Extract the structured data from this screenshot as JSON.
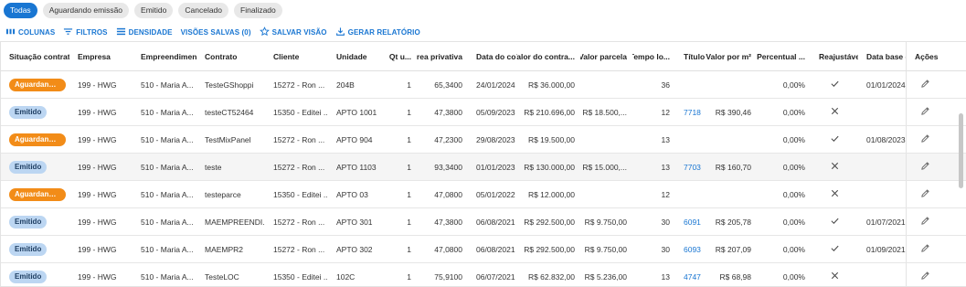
{
  "tabs": [
    {
      "label": "Todas",
      "active": true
    },
    {
      "label": "Aguardando emissão",
      "active": false
    },
    {
      "label": "Emitido",
      "active": false
    },
    {
      "label": "Cancelado",
      "active": false
    },
    {
      "label": "Finalizado",
      "active": false
    }
  ],
  "toolbar": {
    "columns": "COLUNAS",
    "filters": "FILTROS",
    "density": "DENSIDADE",
    "saved_views": "VISÕES SALVAS (0)",
    "save_view": "SALVAR VISÃO",
    "report": "GERAR RELATÓRIO"
  },
  "columns": {
    "situacao": "Situação contrato",
    "empresa": "Empresa",
    "empreendimento": "Empreendimento",
    "contrato": "Contrato",
    "cliente": "Cliente",
    "unidade": "Unidade",
    "qt": "Qt u...",
    "area": "Área privativa",
    "data": "Data do con...",
    "valor": "Valor do contra...",
    "parcela": "Valor parcela",
    "tempo": "Tempo lo...",
    "titulo": "Título",
    "valor_m2": "Valor por m²",
    "percentual": "Percentual ...",
    "reajustavel": "Reajustável",
    "data_base": "Data base d...",
    "acoes": "Ações"
  },
  "colors": {
    "primary": "#1976d2",
    "orange": "#f28c18",
    "blue_badge": "#bcd6f2"
  },
  "rows": [
    {
      "status": "Aguardando ...",
      "status_type": "orange",
      "empresa": "199 - HWG",
      "empreendimento": "510 - Maria A...",
      "contrato": "TesteGShoppi",
      "cliente": "15272 - Ron ...",
      "unidade": "204B",
      "qt": "1",
      "area": "65,3400",
      "data": "24/01/2024",
      "valor": "R$ 36.000,00",
      "parcela": "",
      "tempo": "36",
      "titulo": "",
      "valor_m2": "",
      "percentual": "0,00%",
      "reajustavel": "check",
      "data_base": "01/01/2024",
      "highlight": false
    },
    {
      "status": "Emitido",
      "status_type": "blue",
      "empresa": "199 - HWG",
      "empreendimento": "510 - Maria A...",
      "contrato": "testeCT52464",
      "cliente": "15350 - Editei ...",
      "unidade": "APTO 1001",
      "qt": "1",
      "area": "47,3800",
      "data": "05/09/2023",
      "valor": "R$ 210.696,00",
      "parcela": "R$ 18.500,...",
      "tempo": "12",
      "titulo": "7718",
      "valor_m2": "R$ 390,46",
      "percentual": "0,00%",
      "reajustavel": "close",
      "data_base": "",
      "highlight": false
    },
    {
      "status": "Aguardando ...",
      "status_type": "orange",
      "empresa": "199 - HWG",
      "empreendimento": "510 - Maria A...",
      "contrato": "TestMixPanel",
      "cliente": "15272 - Ron ...",
      "unidade": "APTO 904",
      "qt": "1",
      "area": "47,2300",
      "data": "29/08/2023",
      "valor": "R$ 19.500,00",
      "parcela": "",
      "tempo": "13",
      "titulo": "",
      "valor_m2": "",
      "percentual": "0,00%",
      "reajustavel": "check",
      "data_base": "01/08/2023",
      "highlight": false
    },
    {
      "status": "Emitido",
      "status_type": "blue",
      "empresa": "199 - HWG",
      "empreendimento": "510 - Maria A...",
      "contrato": "teste",
      "cliente": "15272 - Ron ...",
      "unidade": "APTO 1103",
      "qt": "1",
      "area": "93,3400",
      "data": "01/01/2023",
      "valor": "R$ 130.000,00",
      "parcela": "R$ 15.000,...",
      "tempo": "13",
      "titulo": "7703",
      "valor_m2": "R$ 160,70",
      "percentual": "0,00%",
      "reajustavel": "close",
      "data_base": "",
      "highlight": true
    },
    {
      "status": "Aguardando ...",
      "status_type": "orange",
      "empresa": "199 - HWG",
      "empreendimento": "510 - Maria A...",
      "contrato": "testeparce",
      "cliente": "15350 - Editei ...",
      "unidade": "APTO 03",
      "qt": "1",
      "area": "47,0800",
      "data": "05/01/2022",
      "valor": "R$ 12.000,00",
      "parcela": "",
      "tempo": "12",
      "titulo": "",
      "valor_m2": "",
      "percentual": "0,00%",
      "reajustavel": "close",
      "data_base": "",
      "highlight": false
    },
    {
      "status": "Emitido",
      "status_type": "blue",
      "empresa": "199 - HWG",
      "empreendimento": "510 - Maria A...",
      "contrato": "MAEMPREENDI...",
      "cliente": "15272 - Ron ...",
      "unidade": "APTO 301",
      "qt": "1",
      "area": "47,3800",
      "data": "06/08/2021",
      "valor": "R$ 292.500,00",
      "parcela": "R$ 9.750,00",
      "tempo": "30",
      "titulo": "6091",
      "valor_m2": "R$ 205,78",
      "percentual": "0,00%",
      "reajustavel": "check",
      "data_base": "01/07/2021",
      "highlight": false
    },
    {
      "status": "Emitido",
      "status_type": "blue",
      "empresa": "199 - HWG",
      "empreendimento": "510 - Maria A...",
      "contrato": "MAEMPR2",
      "cliente": "15272 - Ron ...",
      "unidade": "APTO 302",
      "qt": "1",
      "area": "47,0800",
      "data": "06/08/2021",
      "valor": "R$ 292.500,00",
      "parcela": "R$ 9.750,00",
      "tempo": "30",
      "titulo": "6093",
      "valor_m2": "R$ 207,09",
      "percentual": "0,00%",
      "reajustavel": "check",
      "data_base": "01/09/2021",
      "highlight": false
    },
    {
      "status": "Emitido",
      "status_type": "blue",
      "empresa": "199 - HWG",
      "empreendimento": "510 - Maria A...",
      "contrato": "TesteLOC",
      "cliente": "15350 - Editei ...",
      "unidade": "102C",
      "qt": "1",
      "area": "75,9100",
      "data": "06/07/2021",
      "valor": "R$ 62.832,00",
      "parcela": "R$ 5.236,00",
      "tempo": "13",
      "titulo": "4747",
      "valor_m2": "R$ 68,98",
      "percentual": "0,00%",
      "reajustavel": "close",
      "data_base": "",
      "highlight": false
    }
  ]
}
